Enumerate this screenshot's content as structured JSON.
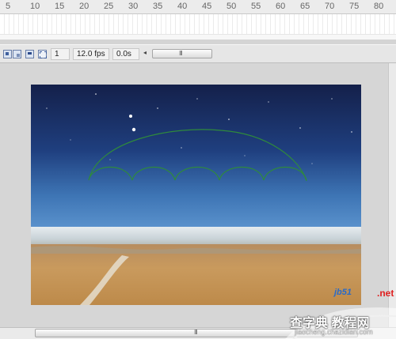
{
  "timeline": {
    "ruler_labels": [
      "5",
      "10",
      "15",
      "20",
      "25",
      "30",
      "35",
      "40",
      "45",
      "50",
      "55",
      "60",
      "65",
      "70",
      "75",
      "80"
    ]
  },
  "status_bar": {
    "icons": [
      "center-frame-icon",
      "onion-skin-icon",
      "onion-outline-icon",
      "edit-multiple-frames-icon"
    ],
    "current_frame": "1",
    "frame_rate": "12.0 fps",
    "elapsed_time": "0.0s",
    "scroll_left_arrow": "◂",
    "thumb_grip": "III"
  },
  "stage": {
    "image_description_icon": "night-sky-beach-image",
    "sky_top_color": "#14204a",
    "sky_horizon_color": "#4f88c6",
    "sand_color": "#c79656",
    "arc_stroke_color": "#2f8a3c"
  },
  "bottom_scroll": {
    "thumb_grip": "III"
  },
  "watermark": {
    "red_text": ".net",
    "blue_text": "jb51",
    "cn_text": "查字典 教程网",
    "url": "jiaocheng.chazidian.com"
  }
}
